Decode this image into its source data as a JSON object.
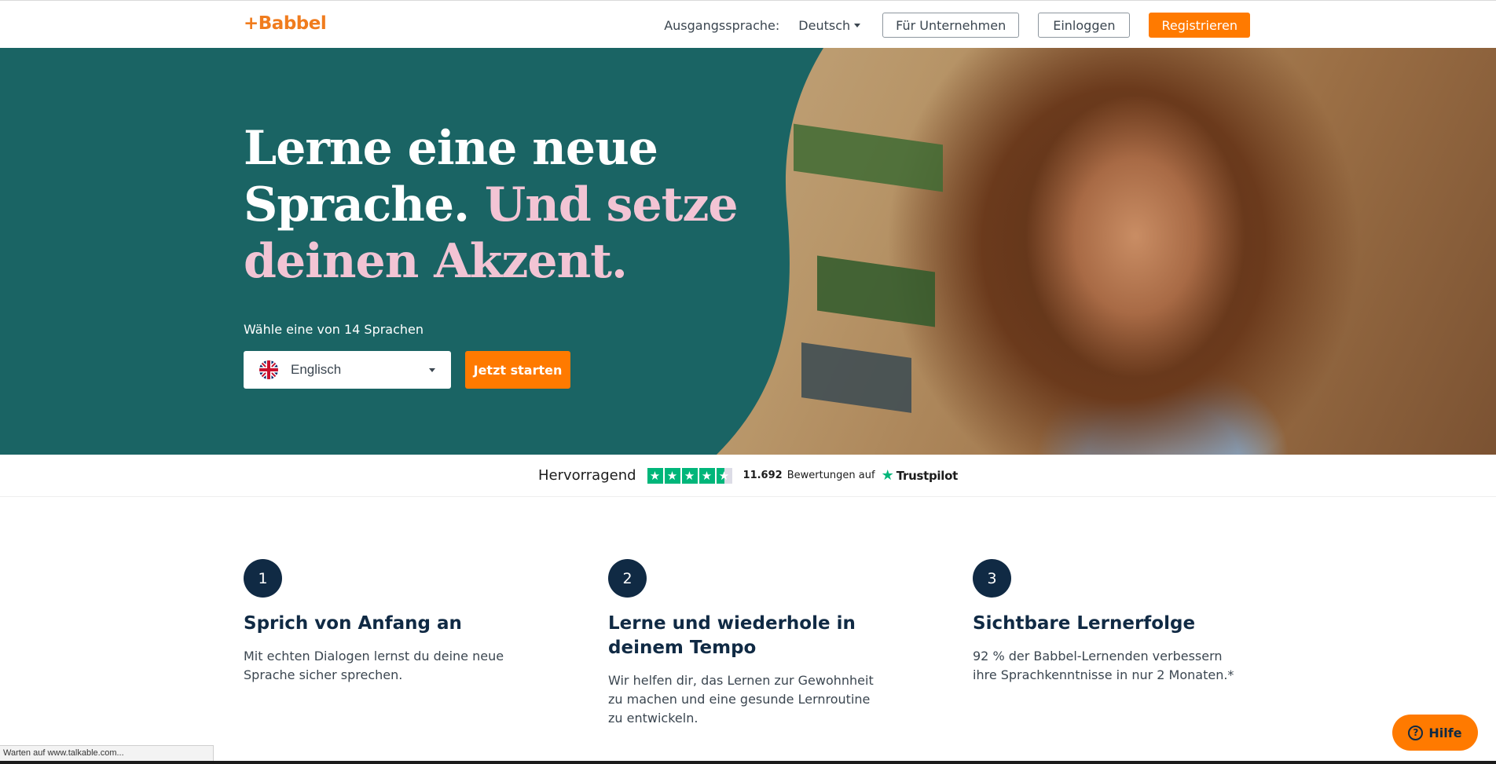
{
  "header": {
    "logo": "+Babbel",
    "source_language_label": "Ausgangssprache:",
    "source_language_value": "Deutsch",
    "business_button": "Für Unternehmen",
    "login_button": "Einloggen",
    "register_button": "Registrieren"
  },
  "hero": {
    "headline_part1": "Lerne eine neue Sprache.",
    "headline_part2": "Und setze deinen Akzent",
    "headline_period": ".",
    "subtitle": "Wähle eine von 14 Sprachen",
    "language_select_value": "Englisch",
    "start_button": "Jetzt starten"
  },
  "trustpilot": {
    "rating_label": "Hervorragend",
    "stars": 4.5,
    "review_count": "11.692",
    "review_text": "Bewertungen auf",
    "brand": "Trustpilot"
  },
  "features": [
    {
      "number": "1",
      "title": "Sprich von Anfang an",
      "text": "Mit echten Dialogen lernst du deine neue Sprache sicher sprechen."
    },
    {
      "number": "2",
      "title": "Lerne und wiederhole in deinem Tempo",
      "text": "Wir helfen dir, das Lernen zur Gewohnheit zu machen und eine gesunde Lernroutine zu entwickeln."
    },
    {
      "number": "3",
      "title": "Sichtbare Lernerfolge",
      "text": "92 % der Babbel-Lernenden verbessern ihre Sprachkenntnisse in nur 2 Monaten.*"
    }
  ],
  "help_button": "Hilfe",
  "status_bar": "Warten auf www.talkable.com...",
  "colors": {
    "brand_orange": "#ff7a00",
    "hero_teal": "#1a6464",
    "accent_pink": "#f2c4d4",
    "navy": "#102a44"
  }
}
